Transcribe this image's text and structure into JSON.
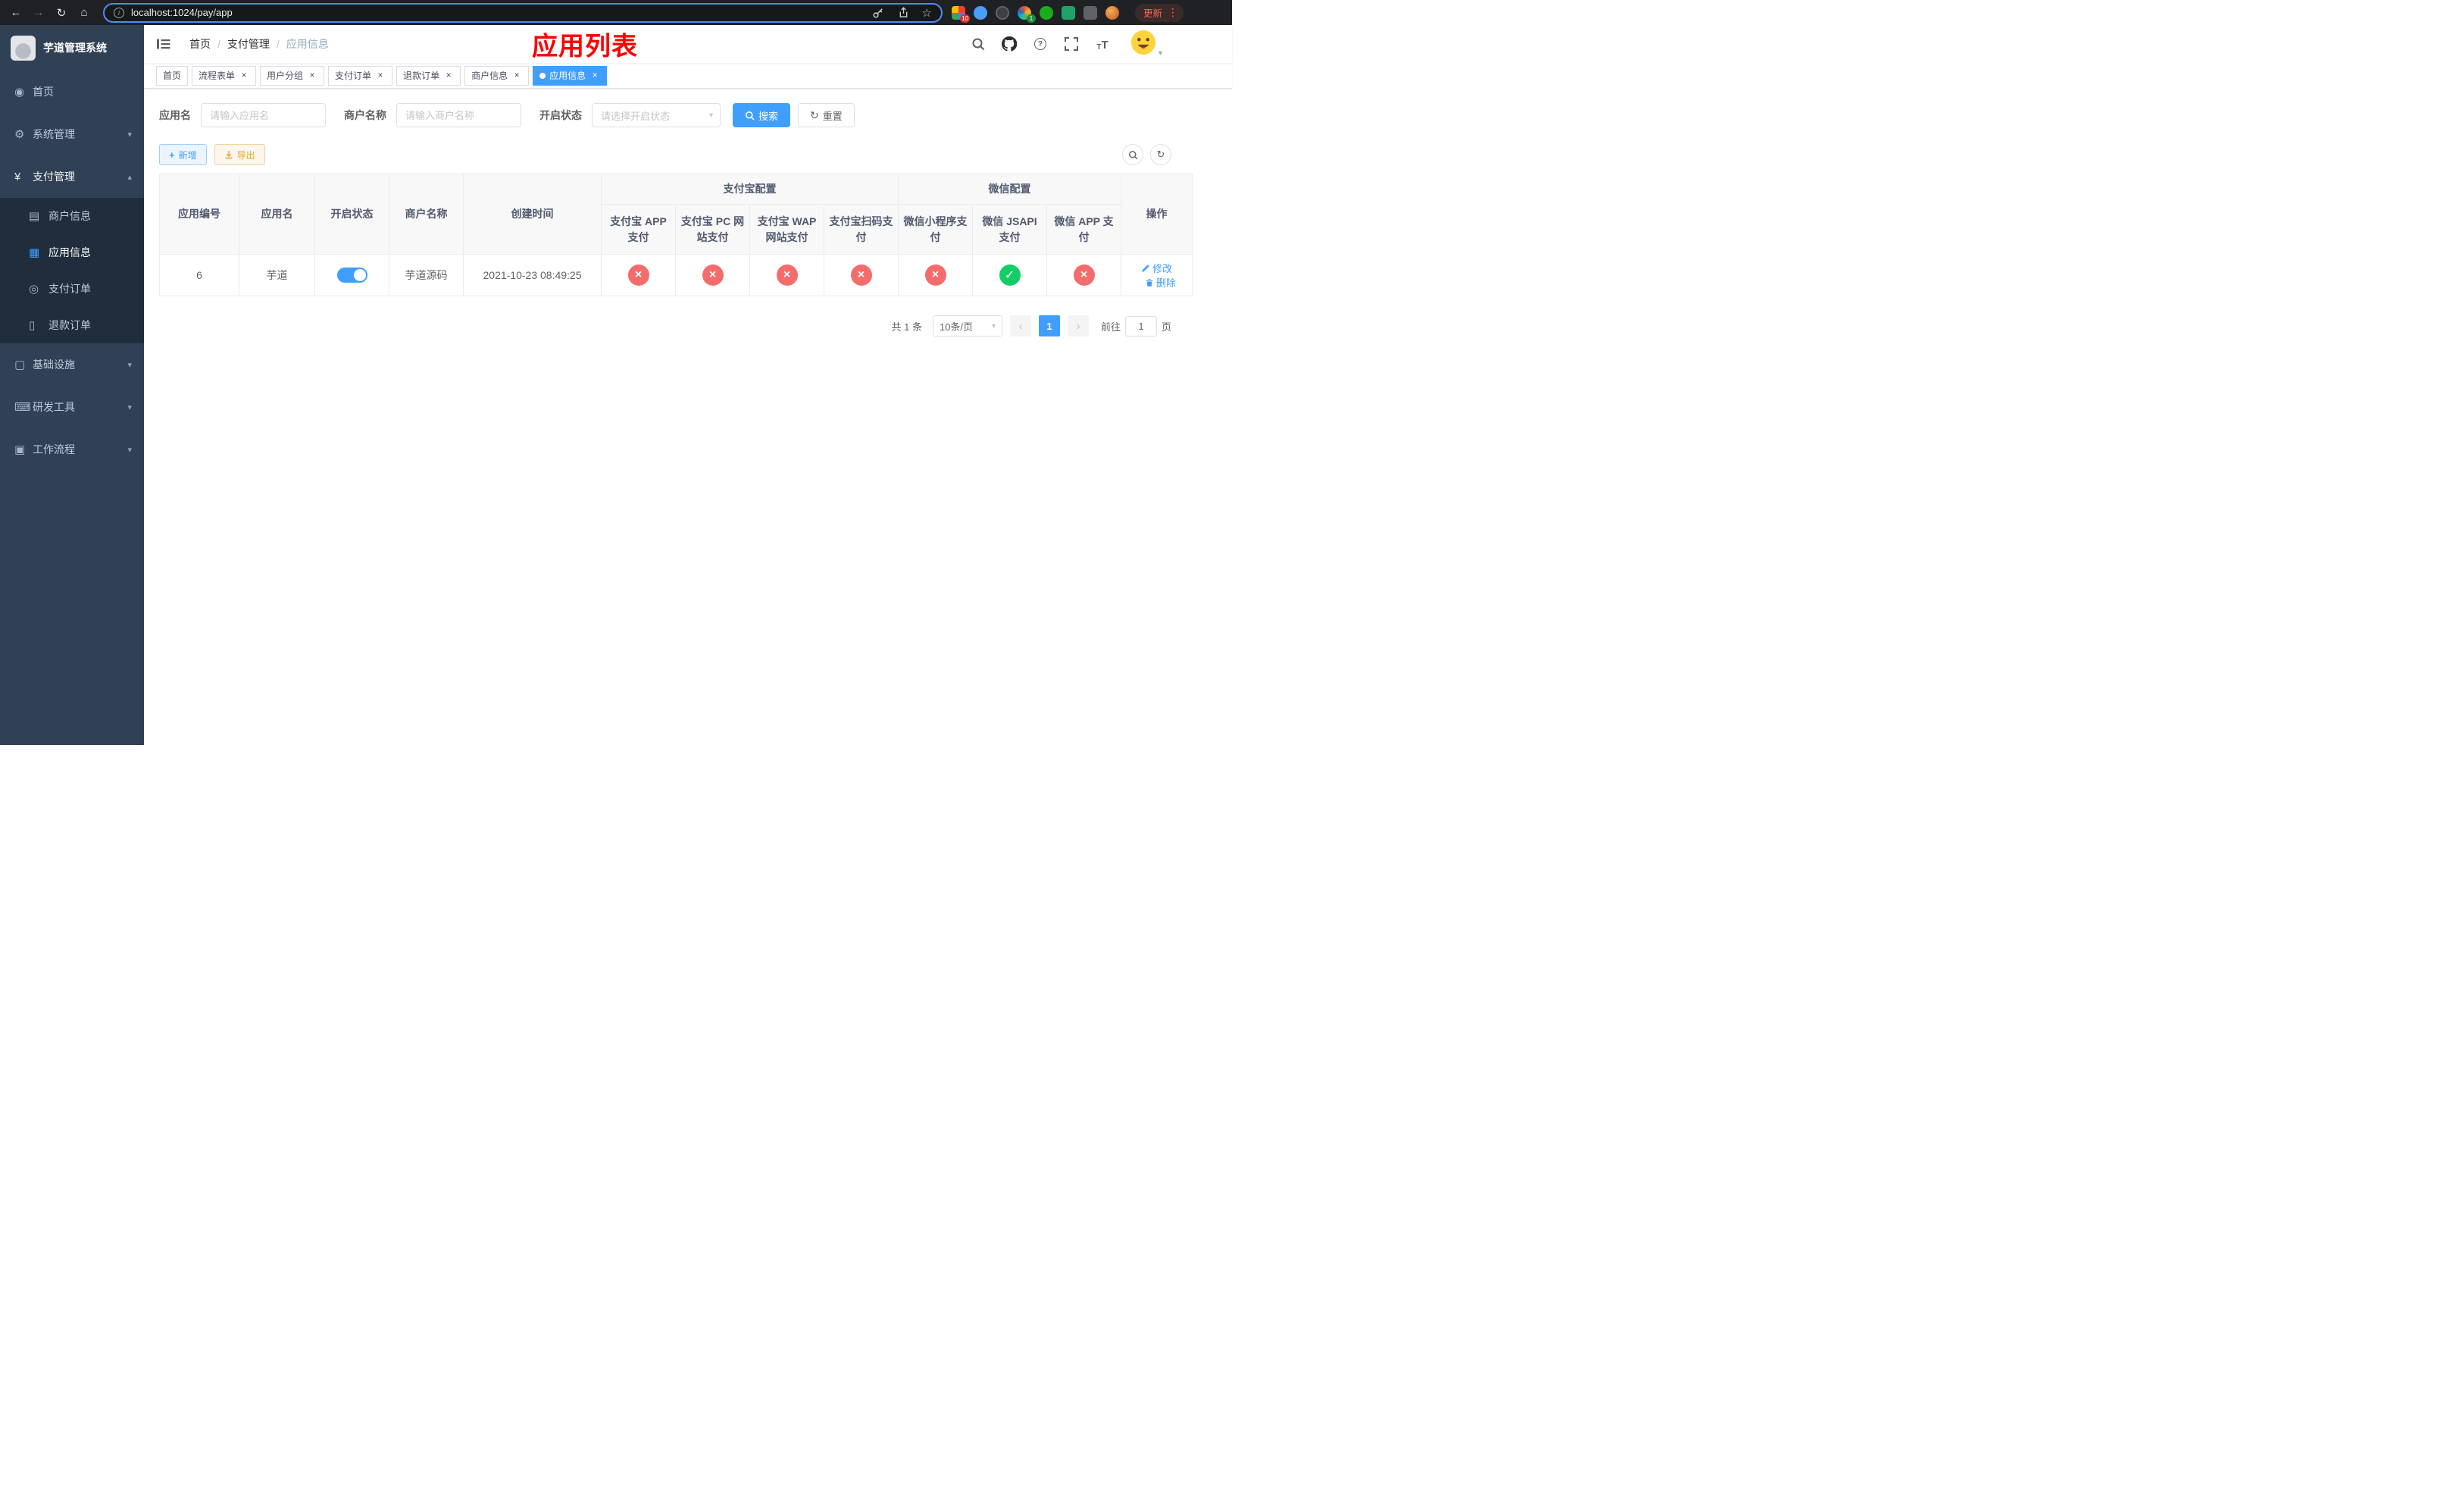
{
  "colors": {
    "primary": "#409eff",
    "danger": "#f56c6c",
    "success": "#13ce66",
    "warning": "#e6a23c",
    "annotation_red": "#ff0000",
    "sidebar_bg": "#304156",
    "submenu_bg": "#1f2d3d"
  },
  "browser": {
    "url": "localhost:1024/pay/app",
    "update_label": "更新",
    "badges": [
      "10",
      "1"
    ]
  },
  "sidebar": {
    "title": "芋道管理系统",
    "items": [
      {
        "label": "首页"
      },
      {
        "label": "系统管理"
      },
      {
        "label": "支付管理"
      },
      {
        "label": "基础设施"
      },
      {
        "label": "研发工具"
      },
      {
        "label": "工作流程"
      }
    ],
    "payment_children": [
      {
        "label": "商户信息"
      },
      {
        "label": "应用信息"
      },
      {
        "label": "支付订单"
      },
      {
        "label": "退款订单"
      }
    ]
  },
  "header": {
    "breadcrumb": [
      "首页",
      "支付管理",
      "应用信息"
    ],
    "annotation": "应用列表"
  },
  "tabs": [
    {
      "label": "首页"
    },
    {
      "label": "流程表单"
    },
    {
      "label": "用户分组"
    },
    {
      "label": "支付订单"
    },
    {
      "label": "退款订单"
    },
    {
      "label": "商户信息"
    },
    {
      "label": "应用信息"
    }
  ],
  "filters": {
    "app_name_label": "应用名",
    "app_name_placeholder": "请输入应用名",
    "merchant_label": "商户名称",
    "merchant_placeholder": "请输入商户名称",
    "status_label": "开启状态",
    "status_placeholder": "请选择开启状态",
    "search_label": "搜索",
    "reset_label": "重置"
  },
  "toolbar": {
    "add_label": "新增",
    "export_label": "导出"
  },
  "table": {
    "headers": {
      "id": "应用编号",
      "name": "应用名",
      "status": "开启状态",
      "merchant": "商户名称",
      "created": "创建时间",
      "alipay_group": "支付宝配置",
      "wechat_group": "微信配置",
      "cols": [
        "支付宝 APP 支付",
        "支付宝 PC 网站支付",
        "支付宝 WAP 网站支付",
        "支付宝扫码支付",
        "微信小程序支付",
        "微信 JSAPI 支付",
        "微信 APP 支付"
      ],
      "actions": "操作"
    },
    "row": {
      "id": "6",
      "name": "芋道",
      "enabled": true,
      "merchant": "芋道源码",
      "created": "2021-10-23 08:49:25",
      "statuses": [
        false,
        false,
        false,
        false,
        false,
        true,
        false
      ],
      "edit_label": "修改",
      "delete_label": "删除"
    }
  },
  "pagination": {
    "total": "共 1 条",
    "page_size": "10条/页",
    "page": "1",
    "goto_label": "前往",
    "goto_value": "1",
    "goto_suffix": "页"
  }
}
